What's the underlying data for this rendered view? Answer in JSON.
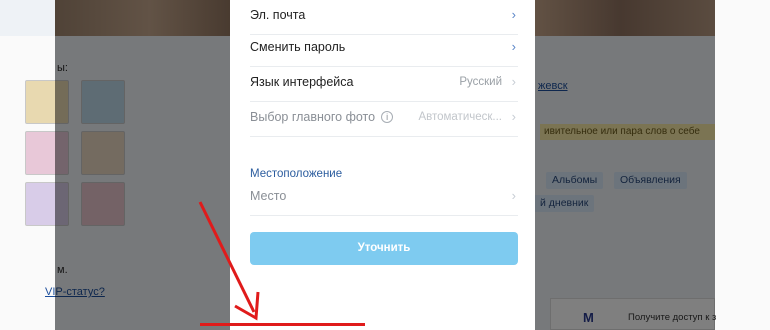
{
  "modal": {
    "rows": [
      {
        "label": "Эл. почта",
        "value": "",
        "chevron": "›"
      },
      {
        "label": "Сменить пароль",
        "value": "",
        "chevron": "›"
      },
      {
        "label": "Язык интерфейса",
        "value": "Русский",
        "chevron": "›"
      },
      {
        "label": "Выбор главного фото",
        "info": "i",
        "value": "Автоматическ...",
        "chevron": "›"
      }
    ],
    "location_section": {
      "title": "Местоположение",
      "field_label": "Место",
      "chevron": "›"
    },
    "submit_label": "Уточнить"
  },
  "background": {
    "left_label": "ы:",
    "left_text": "м.",
    "left_link": "VIP-статус?",
    "right_link": "жевск",
    "yellow_text": "ивительное или пара слов о себе",
    "chips": [
      "Альбомы",
      "Объявления",
      "й дневник"
    ],
    "ad_logo": "M",
    "ad_text": "Получите доступ к з"
  },
  "colors": {
    "accent_blue": "#2b5c9e",
    "submit_bg": "#7ecbf0",
    "annotation_red": "#e01b1b"
  }
}
